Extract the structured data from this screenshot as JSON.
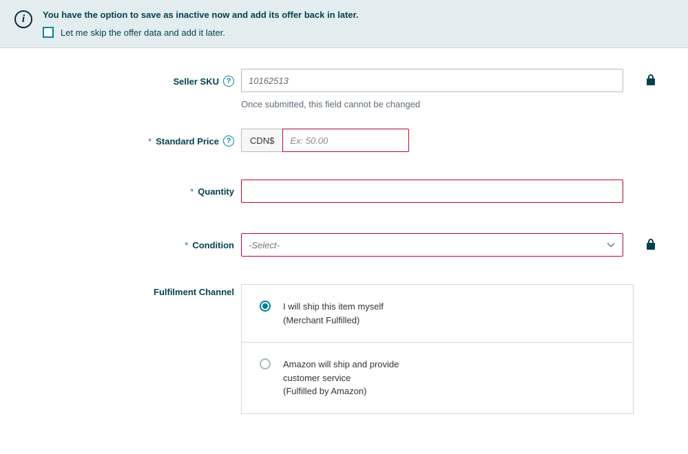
{
  "notice": {
    "title": "You have the option to save as inactive now and add its offer back in later.",
    "check_label": "Let me skip the offer data and add it later."
  },
  "form": {
    "seller_sku": {
      "label": "Seller SKU",
      "value": "10162513",
      "helper": "Once submitted, this field cannot be changed"
    },
    "standard_price": {
      "label": "Standard Price",
      "currency": "CDN$",
      "placeholder": "Ex: 50.00"
    },
    "quantity": {
      "label": "Quantity",
      "value": ""
    },
    "condition": {
      "label": "Condition",
      "placeholder": "-Select-"
    },
    "fulfilment": {
      "label": "Fulfilment Channel",
      "option_self_line1": "I will ship this item myself",
      "option_self_line2": "(Merchant Fulfilled)",
      "option_amazon_line1": "Amazon will ship and provide customer service",
      "option_amazon_line2": "(Fulfilled by Amazon)"
    }
  }
}
